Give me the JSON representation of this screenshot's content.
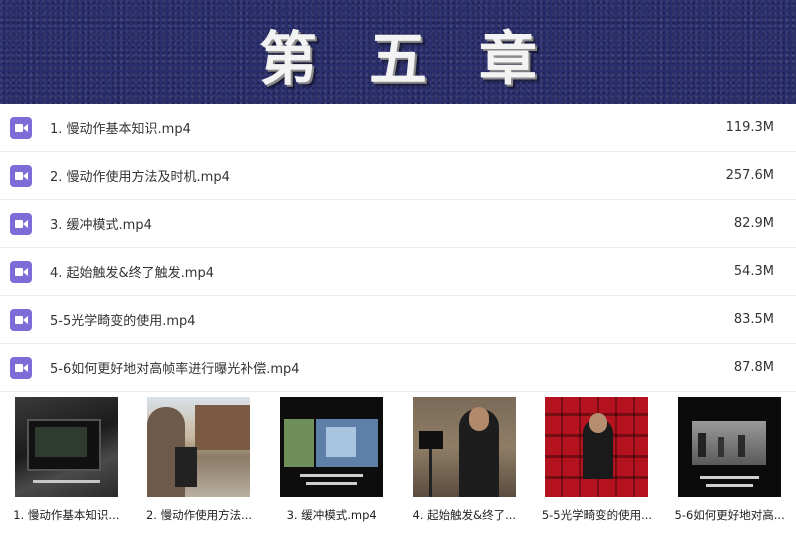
{
  "banner": {
    "title": "第五章"
  },
  "files": [
    {
      "name": "1. 慢动作基本知识.mp4",
      "size": "119.3M",
      "icon": "video-file-icon"
    },
    {
      "name": "2. 慢动作使用方法及时机.mp4",
      "size": "257.6M",
      "icon": "video-file-icon"
    },
    {
      "name": "3. 缓冲模式.mp4",
      "size": "82.9M",
      "icon": "video-file-icon"
    },
    {
      "name": "4. 起始触发&终了触发.mp4",
      "size": "54.3M",
      "icon": "video-file-icon"
    },
    {
      "name": "5-5光学畸变的使用.mp4",
      "size": "83.5M",
      "icon": "video-file-icon"
    },
    {
      "name": "5-6如何更好地对高帧率进行曝光补偿.mp4",
      "size": "87.8M",
      "icon": "video-file-icon"
    }
  ],
  "thumbnails": [
    {
      "caption": "1. 慢动作基本知识..."
    },
    {
      "caption": "2. 慢动作使用方法..."
    },
    {
      "caption": "3. 缓冲模式.mp4"
    },
    {
      "caption": "4. 起始触发&终了..."
    },
    {
      "caption": "5-5光学畸变的使用..."
    },
    {
      "caption": "5-6如何更好地对高..."
    }
  ],
  "colors": {
    "banner": "#2b2f6e",
    "icon": "#7e6bd8"
  }
}
